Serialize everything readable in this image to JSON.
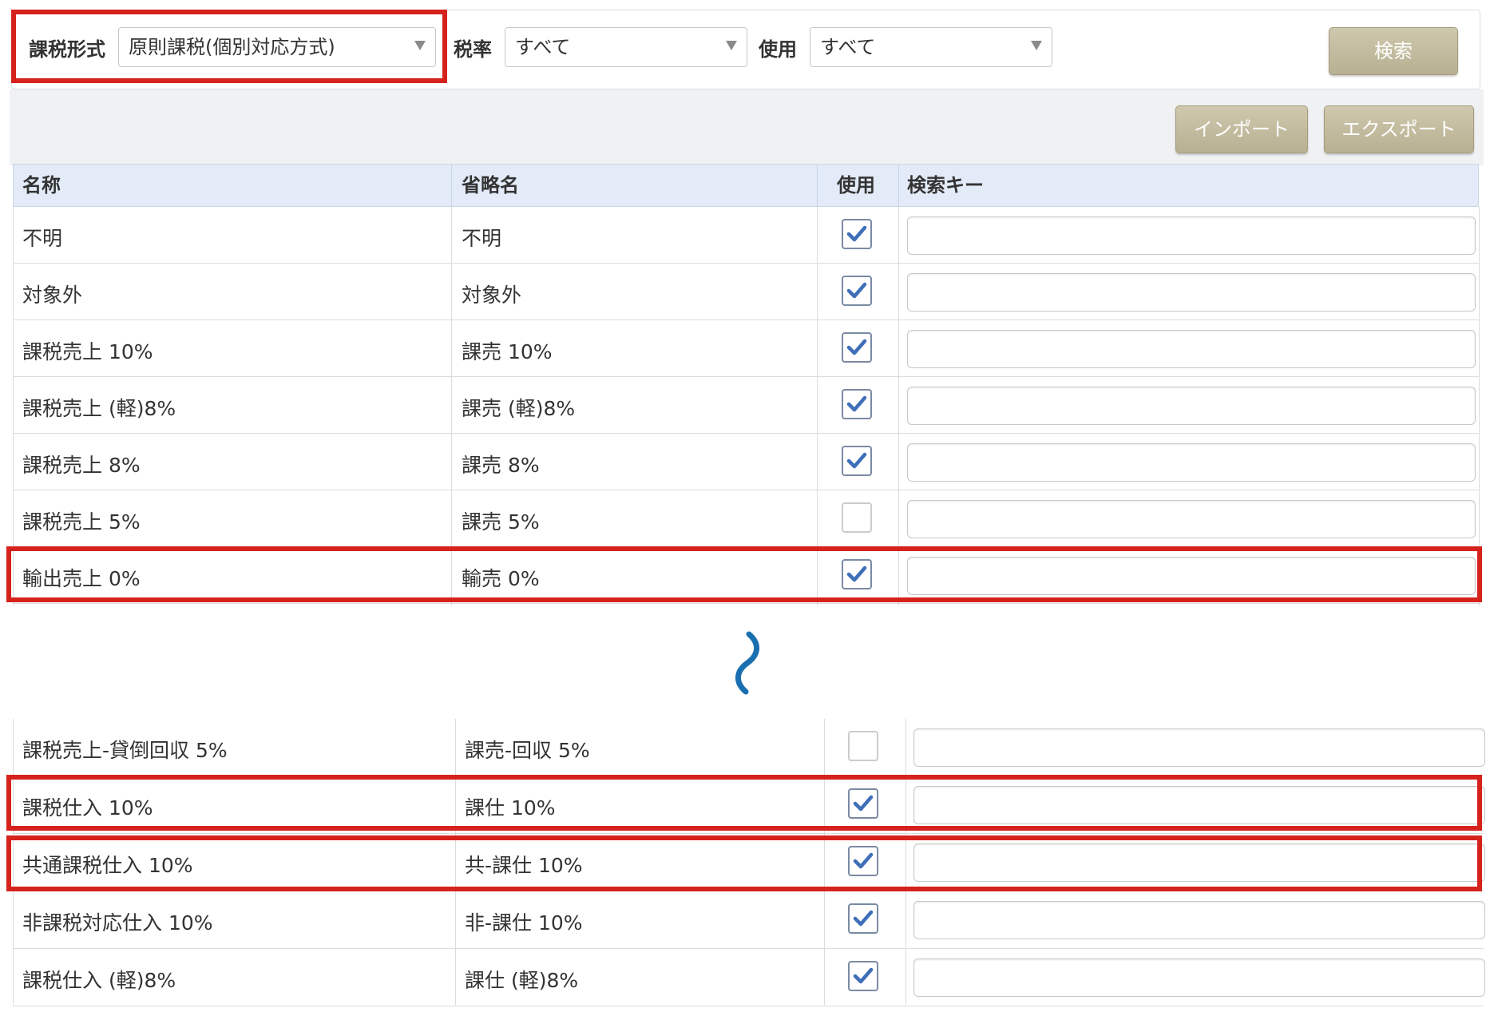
{
  "filters": {
    "tax_form": {
      "label": "課税形式",
      "value": "原則課税(個別対応方式)"
    },
    "tax_rate": {
      "label": "税率",
      "value": "すべて"
    },
    "usage": {
      "label": "使用",
      "value": "すべて"
    },
    "search_button": "検索"
  },
  "actions": {
    "import": "インポート",
    "export": "エクスポート"
  },
  "table": {
    "headers": {
      "name": "名称",
      "abbr": "省略名",
      "use": "使用",
      "key": "検索キー"
    },
    "rows_top": [
      {
        "name": "不明",
        "abbr": "不明",
        "checked": true
      },
      {
        "name": "対象外",
        "abbr": "対象外",
        "checked": true
      },
      {
        "name": "課税売上 10%",
        "abbr": "課売 10%",
        "checked": true
      },
      {
        "name": "課税売上 (軽)8%",
        "abbr": "課売 (軽)8%",
        "checked": true
      },
      {
        "name": "課税売上 8%",
        "abbr": "課売 8%",
        "checked": true
      },
      {
        "name": "課税売上 5%",
        "abbr": "課売 5%",
        "checked": false
      },
      {
        "name": "輸出売上 0%",
        "abbr": "輸売 0%",
        "checked": true
      }
    ],
    "rows_bottom": [
      {
        "name": "課税売上-貸倒回収 5%",
        "abbr": "課売-回収 5%",
        "checked": false
      },
      {
        "name": "課税仕入 10%",
        "abbr": "課仕 10%",
        "checked": true
      },
      {
        "name": "共通課税仕入 10%",
        "abbr": "共-課仕 10%",
        "checked": true
      },
      {
        "name": "非課税対応仕入 10%",
        "abbr": "非-課仕 10%",
        "checked": true
      },
      {
        "name": "課税仕入 (軽)8%",
        "abbr": "課仕 (軽)8%",
        "checked": true
      }
    ]
  },
  "colors": {
    "highlight": "#d6221c",
    "header_bg": "#e2ebf7",
    "button": "#b8b092",
    "wave": "#1a6fb0"
  }
}
